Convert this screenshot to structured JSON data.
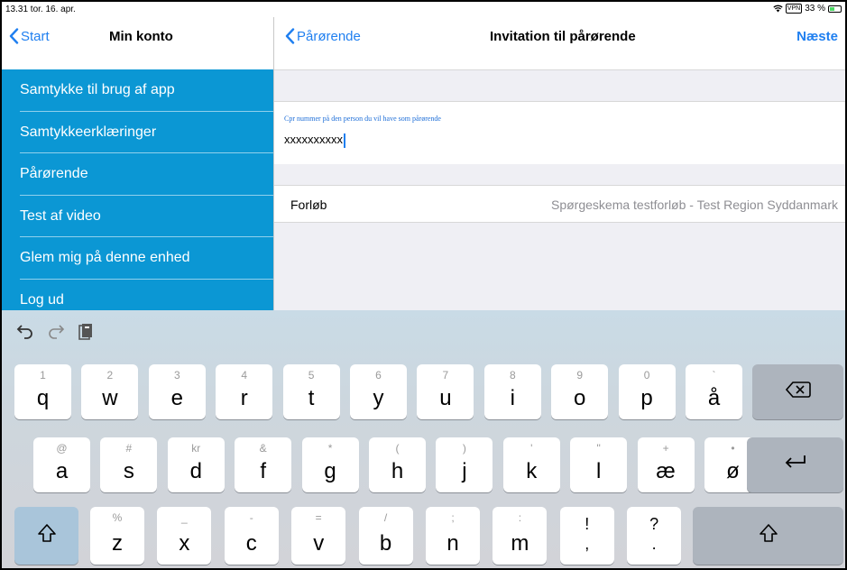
{
  "status_bar": {
    "time": "13.31  tor. 16. apr.",
    "vpn": "VPN",
    "battery": "33 %"
  },
  "left_panel": {
    "back_label": "Start",
    "title": "Min konto",
    "menu": [
      {
        "label": "Samtykke til brug af app"
      },
      {
        "label": "Samtykkeerklæringer"
      },
      {
        "label": "Pårørende"
      },
      {
        "label": "Test af video"
      },
      {
        "label": "Glem mig på denne enhed"
      },
      {
        "label": "Log ud"
      }
    ],
    "menu_color": "#0b97d4"
  },
  "right_panel": {
    "back_label": "Pårørende",
    "title": "Invitation til pårørende",
    "next_label": "Næste",
    "cpr_label": "Cpr nummer på den person du vil have som pårørende",
    "cpr_value": "xxxxxxxxxx",
    "row_key": "Forløb",
    "row_value": "Spørgeskema testforløb - Test Region Syddanmark"
  },
  "keyboard": {
    "row1": [
      {
        "top": "1",
        "main": "q"
      },
      {
        "top": "2",
        "main": "w"
      },
      {
        "top": "3",
        "main": "e"
      },
      {
        "top": "4",
        "main": "r"
      },
      {
        "top": "5",
        "main": "t"
      },
      {
        "top": "6",
        "main": "y"
      },
      {
        "top": "7",
        "main": "u"
      },
      {
        "top": "8",
        "main": "i"
      },
      {
        "top": "9",
        "main": "o"
      },
      {
        "top": "0",
        "main": "p"
      },
      {
        "top": "`",
        "main": "å"
      }
    ],
    "row2": [
      {
        "top": "@",
        "main": "a"
      },
      {
        "top": "#",
        "main": "s"
      },
      {
        "top": "kr",
        "main": "d"
      },
      {
        "top": "&",
        "main": "f"
      },
      {
        "top": "*",
        "main": "g"
      },
      {
        "top": "(",
        "main": "h"
      },
      {
        "top": ")",
        "main": "j"
      },
      {
        "top": "'",
        "main": "k"
      },
      {
        "top": "\"",
        "main": "l"
      },
      {
        "top": "+",
        "main": "æ"
      },
      {
        "top": "•",
        "main": "ø"
      }
    ],
    "row3": [
      {
        "top": "%",
        "main": "z"
      },
      {
        "top": "_",
        "main": "x"
      },
      {
        "top": "-",
        "main": "c"
      },
      {
        "top": "=",
        "main": "v"
      },
      {
        "top": "/",
        "main": "b"
      },
      {
        "top": ";",
        "main": "n"
      },
      {
        "top": ":",
        "main": "m"
      },
      {
        "top": "!",
        "main": ","
      },
      {
        "top": "?",
        "main": "."
      }
    ]
  }
}
